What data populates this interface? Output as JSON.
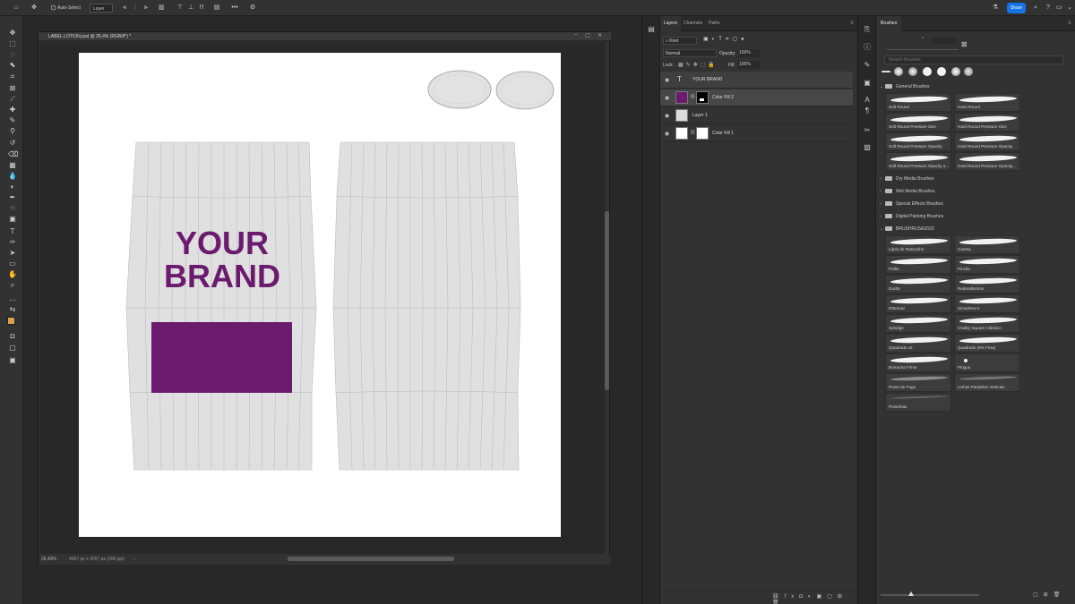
{
  "optionsbar": {
    "auto_select_label": "Auto-Select",
    "layer_select_value": "Layer",
    "share_label": "Share"
  },
  "document": {
    "tab_title": "LABEL-LOTION.psd @ 26,4% (RGB/8*) *",
    "zoom_level": "26,43%",
    "doc_info": "4267 px x 4267 px (300 ppi)",
    "canvas_text_line1": "YOUR",
    "canvas_text_line2": "BRAND"
  },
  "layers_panel": {
    "tabs": [
      "Layers",
      "Channels",
      "Paths"
    ],
    "filter_value": "Kind",
    "blend_mode": "Normal",
    "opacity_label": "Opacity:",
    "opacity_value": "100%",
    "lock_label": "Lock:",
    "fill_label": "Fill:",
    "fill_value": "100%",
    "layers": [
      {
        "name": "YOUR BRAND"
      },
      {
        "name": "Color Fill 2"
      },
      {
        "name": "Layer 1"
      },
      {
        "name": "Color Fill 1"
      }
    ]
  },
  "brushes_panel": {
    "title": "Brushes",
    "search_placeholder": "Search Brushes",
    "folders": {
      "general": "General Brushes",
      "dry": "Dry Media Brushes",
      "wet": "Wet Media Brushes",
      "special": "Special Effects Brushes",
      "digital": "Digital Painting Brushes",
      "custom": "BRUSHRUSA2023"
    },
    "general_brushes": [
      "Soft Round",
      "Hard Round",
      "Soft Round Pressure Size",
      "Hard Round Pressure Size",
      "Soft Round Pressure Opacity",
      "Hard Round Pressure Opacity",
      "Soft Round Pressure Opacity a...",
      "Hard Round Pressure Opacity..."
    ],
    "custom_brushes": [
      "Lápis de Rascunho",
      "Caneta",
      "Pelão",
      "Pincão",
      "Durão",
      "Redondissimo",
      "D'Bornat",
      "SimaStroc's",
      "Splodge",
      "Chalky Square Clássico",
      "Quadrado v2",
      "Quadrado (5% Flow)",
      "Borracha Firme",
      "Pinguu",
      "Ponto de Fuga",
      "Linhas Paralelas Verticais",
      "Pontinhas"
    ]
  },
  "colors": {
    "brand_purple": "#6a1b6e",
    "foreground": "#d9a14a",
    "share_blue": "#1473e6"
  }
}
